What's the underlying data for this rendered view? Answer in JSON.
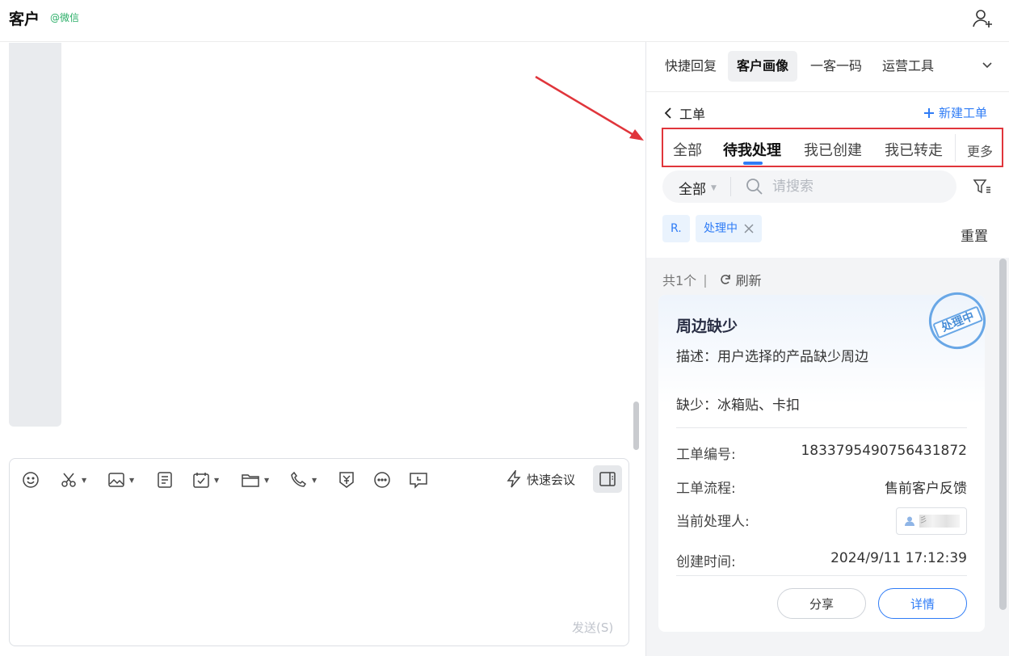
{
  "header": {
    "title": "客户",
    "channel": "@微信",
    "add_user_icon": "add-user-icon"
  },
  "composer": {
    "tools": [
      "emoji-icon",
      "scissors-icon",
      "image-icon",
      "document-icon",
      "calendar-check-icon",
      "folder-icon",
      "phone-icon",
      "payment-icon",
      "more-icon",
      "chat-screen-icon"
    ],
    "quick_meeting": "快速会议",
    "send": "发送(S)"
  },
  "right_panel": {
    "tabs": [
      {
        "label": "快捷回复"
      },
      {
        "label": "客户画像",
        "active": true
      },
      {
        "label": "一客一码"
      },
      {
        "label": "运营工具"
      }
    ],
    "back_label": "工单",
    "new_button": "新建工单",
    "sub_tabs": [
      {
        "label": "全部"
      },
      {
        "label": "待我处理",
        "active": true
      },
      {
        "label": "我已创建"
      },
      {
        "label": "我已转走"
      }
    ],
    "more_label": "更多",
    "scope": "全部",
    "search_placeholder": "请搜索",
    "chips": [
      {
        "label": "R."
      },
      {
        "label": "处理中"
      }
    ],
    "reset": "重置",
    "count": "共1个",
    "refresh": "刷新",
    "ticket": {
      "stamp": "处理中",
      "title": "周边缺少",
      "desc_label": "描述：",
      "desc": "用户选择的产品缺少周边",
      "missing_label": "缺少：",
      "missing": "冰箱贴、卡扣",
      "fields": [
        {
          "label": "工单编号:",
          "value": "1833795490756431872"
        },
        {
          "label": "工单流程:",
          "value": "售前客户反馈"
        },
        {
          "label": "当前处理人:",
          "value": "彡"
        },
        {
          "label": "创建时间:",
          "value": "2024/9/11 17:12:39"
        }
      ],
      "share": "分享",
      "detail": "详情"
    }
  },
  "colors": {
    "accent": "#2f7cf6",
    "highlight_box": "#e0353b",
    "channel_green": "#2aae67"
  }
}
